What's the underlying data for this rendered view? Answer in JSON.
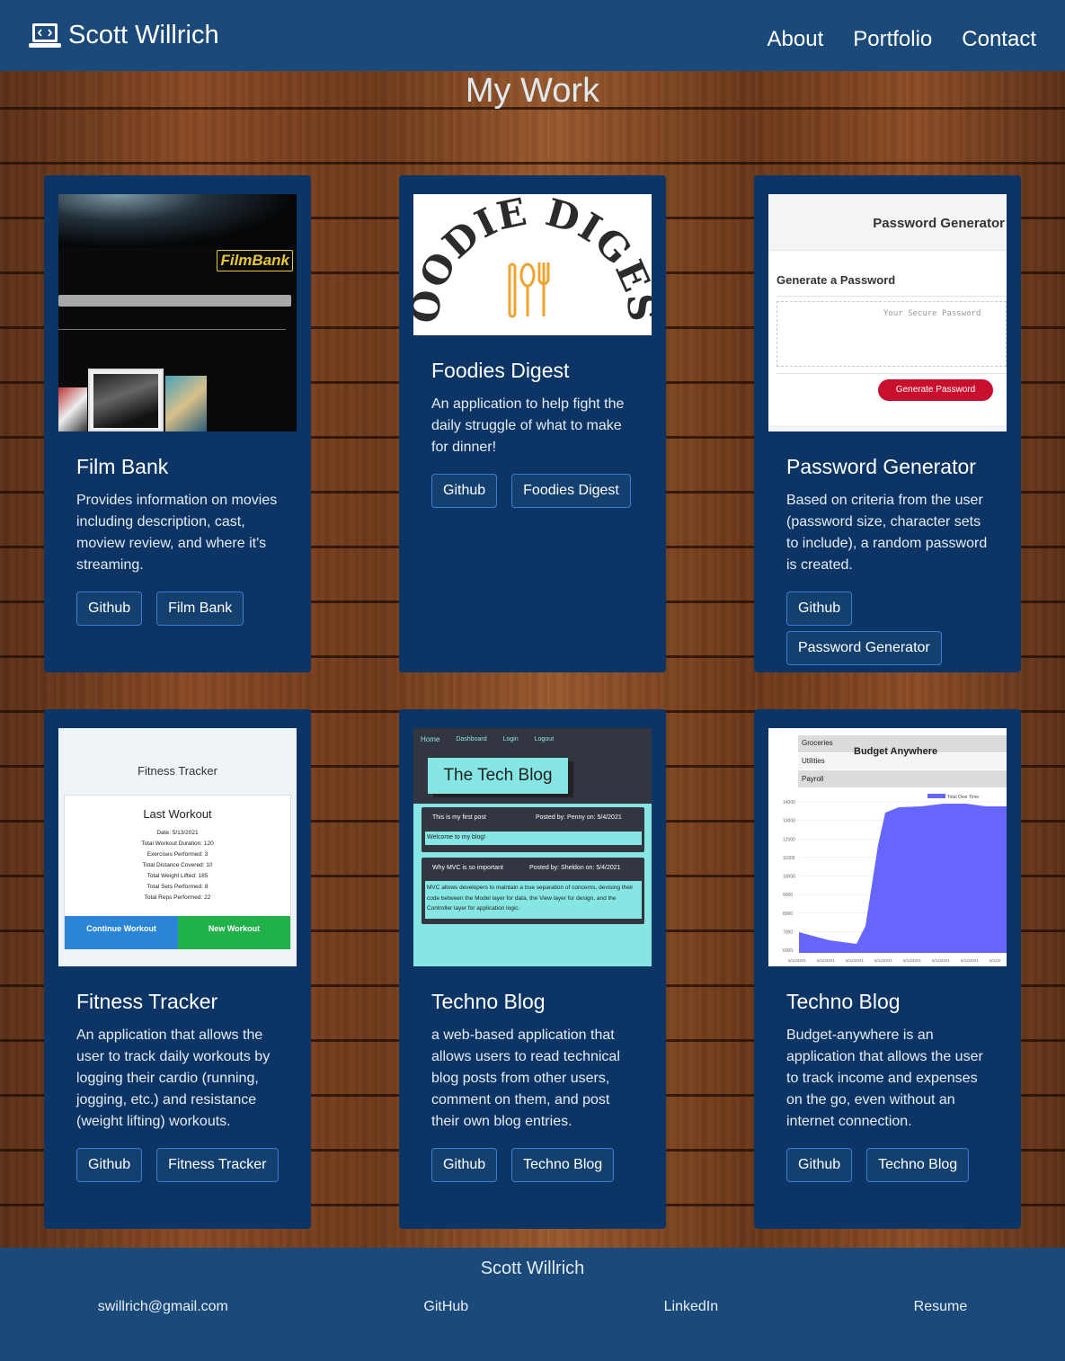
{
  "nav": {
    "brand": "Scott Willrich",
    "links": [
      "About",
      "Portfolio",
      "Contact"
    ]
  },
  "page_title": "My Work",
  "cards": [
    {
      "title": "Film Bank",
      "text": "Provides information on movies including description, cast, moview review, and where it's streaming.",
      "buttons": [
        "Github",
        "Film Bank"
      ],
      "image_text": {
        "logo": "FilmBank"
      }
    },
    {
      "title": "Foodies Digest",
      "text": "An application to help fight the daily struggle of what to make for dinner!",
      "buttons": [
        "Github",
        "Foodies Digest"
      ],
      "image_text": {
        "logo": "FOODIE DIGEST"
      }
    },
    {
      "title": "Password Generator",
      "text": "Based on criteria from the user (password size, character sets to include), a random password is created.",
      "buttons": [
        "Github",
        "Password Generator"
      ],
      "image_text": {
        "header": "Password Generator",
        "subheader": "Generate a Password",
        "placeholder": "Your Secure Password",
        "button": "Generate Password"
      }
    },
    {
      "title": "Fitness Tracker",
      "text": "An application that allows the user to track daily workouts by logging their cardio (running, jogging, etc.) and resistance (weight lifting) workouts.",
      "buttons": [
        "Github",
        "Fitness Tracker"
      ],
      "image_text": {
        "header": "Fitness Tracker",
        "card_title": "Last Workout",
        "rows": [
          "Date: 5/13/2021",
          "Total Workout Duration: 120",
          "Exercises Performed: 3",
          "Total Distance Covered: 10",
          "Total Weight Lifted: 185",
          "Total Sets Performed: 8",
          "Total Reps Performed: 22"
        ],
        "btn_continue": "Continue Workout",
        "btn_new": "New Workout"
      }
    },
    {
      "title": "Techno Blog",
      "text": "a web-based application that allows users to read technical blog posts from other users, comment on them, and post their own blog entries.",
      "buttons": [
        "Github",
        "Techno Blog"
      ],
      "image_text": {
        "nav": [
          "Home",
          "Dashboard",
          "Login",
          "Logout"
        ],
        "heading": "The Tech Blog",
        "post1_title": "This is my first post",
        "post1_meta": "Posted by: Penny on: 5/4/2021",
        "post1_body": "Welcome to my blog!",
        "post2_title": "Why MVC is so important",
        "post2_meta": "Posted by: Sheldon on: 5/4/2021",
        "post2_body": "MVC allows developers to maintain a true separation of concerns, devising their code between the Model layer for data, the View layer for design, and the Controller layer for application logic."
      }
    },
    {
      "title": "Techno Blog",
      "text": "Budget-anywhere is an application that allows the user to track income and expenses on the go, even without an internet connection.",
      "buttons": [
        "Github",
        "Techno Blog"
      ],
      "image_text": {
        "rows": [
          "Groceries",
          "Utilities",
          "Payroll"
        ],
        "header": "Budget Anywhere",
        "legend": "Total Over Time",
        "y_ticks": [
          "14000",
          "13000",
          "12000",
          "11000",
          "10000",
          "9000",
          "8000",
          "7000",
          "6000"
        ],
        "x_ticks": [
          "5/12/2021",
          "5/12/2021",
          "5/12/2021",
          "5/14/2021",
          "5/14/2021",
          "5/14/2021",
          "5/14/2021",
          "5/14/2"
        ]
      }
    }
  ],
  "footer": {
    "name": "Scott Willrich",
    "links": [
      "swillrich@gmail.com",
      "GitHub",
      "LinkedIn",
      "Resume"
    ]
  },
  "colors": {
    "navbar": "#1b4a7a",
    "card": "#0c3566",
    "button_border": "#3c7bd4",
    "chart_fill": "#6666ff"
  }
}
